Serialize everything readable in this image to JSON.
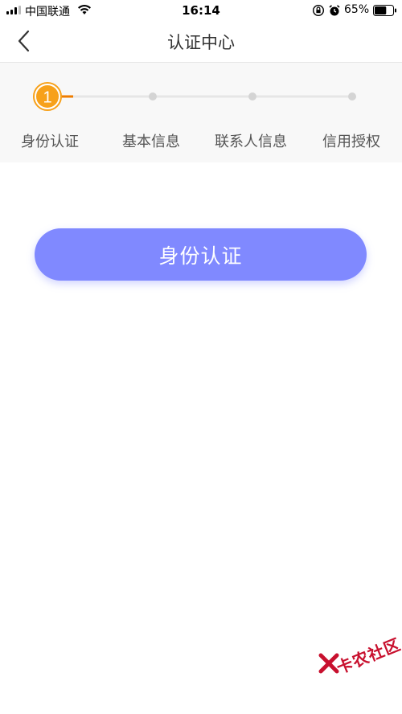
{
  "status_bar": {
    "carrier": "中国联通",
    "time": "16:14",
    "battery_percent": "65%",
    "battery_level": 0.65,
    "icons": [
      "signal-icon",
      "wifi-icon",
      "orientation-lock-icon",
      "alarm-icon",
      "battery-icon"
    ]
  },
  "nav": {
    "title": "认证中心",
    "back_icon": "chevron-left-icon"
  },
  "steps": {
    "current_step": 1,
    "current_number": "1",
    "items": [
      {
        "label": "身份认证"
      },
      {
        "label": "基本信息"
      },
      {
        "label": "联系人信息"
      },
      {
        "label": "信用授权"
      }
    ],
    "colors": {
      "active": "#f7a11a",
      "active_line": "#ee7d00",
      "inactive_dot": "#d4d4d4",
      "inactive_line": "#e6e6e6"
    }
  },
  "main": {
    "button_label": "身份认证",
    "button_color": "#8089ff"
  },
  "watermark": {
    "text": "卡农社区"
  }
}
